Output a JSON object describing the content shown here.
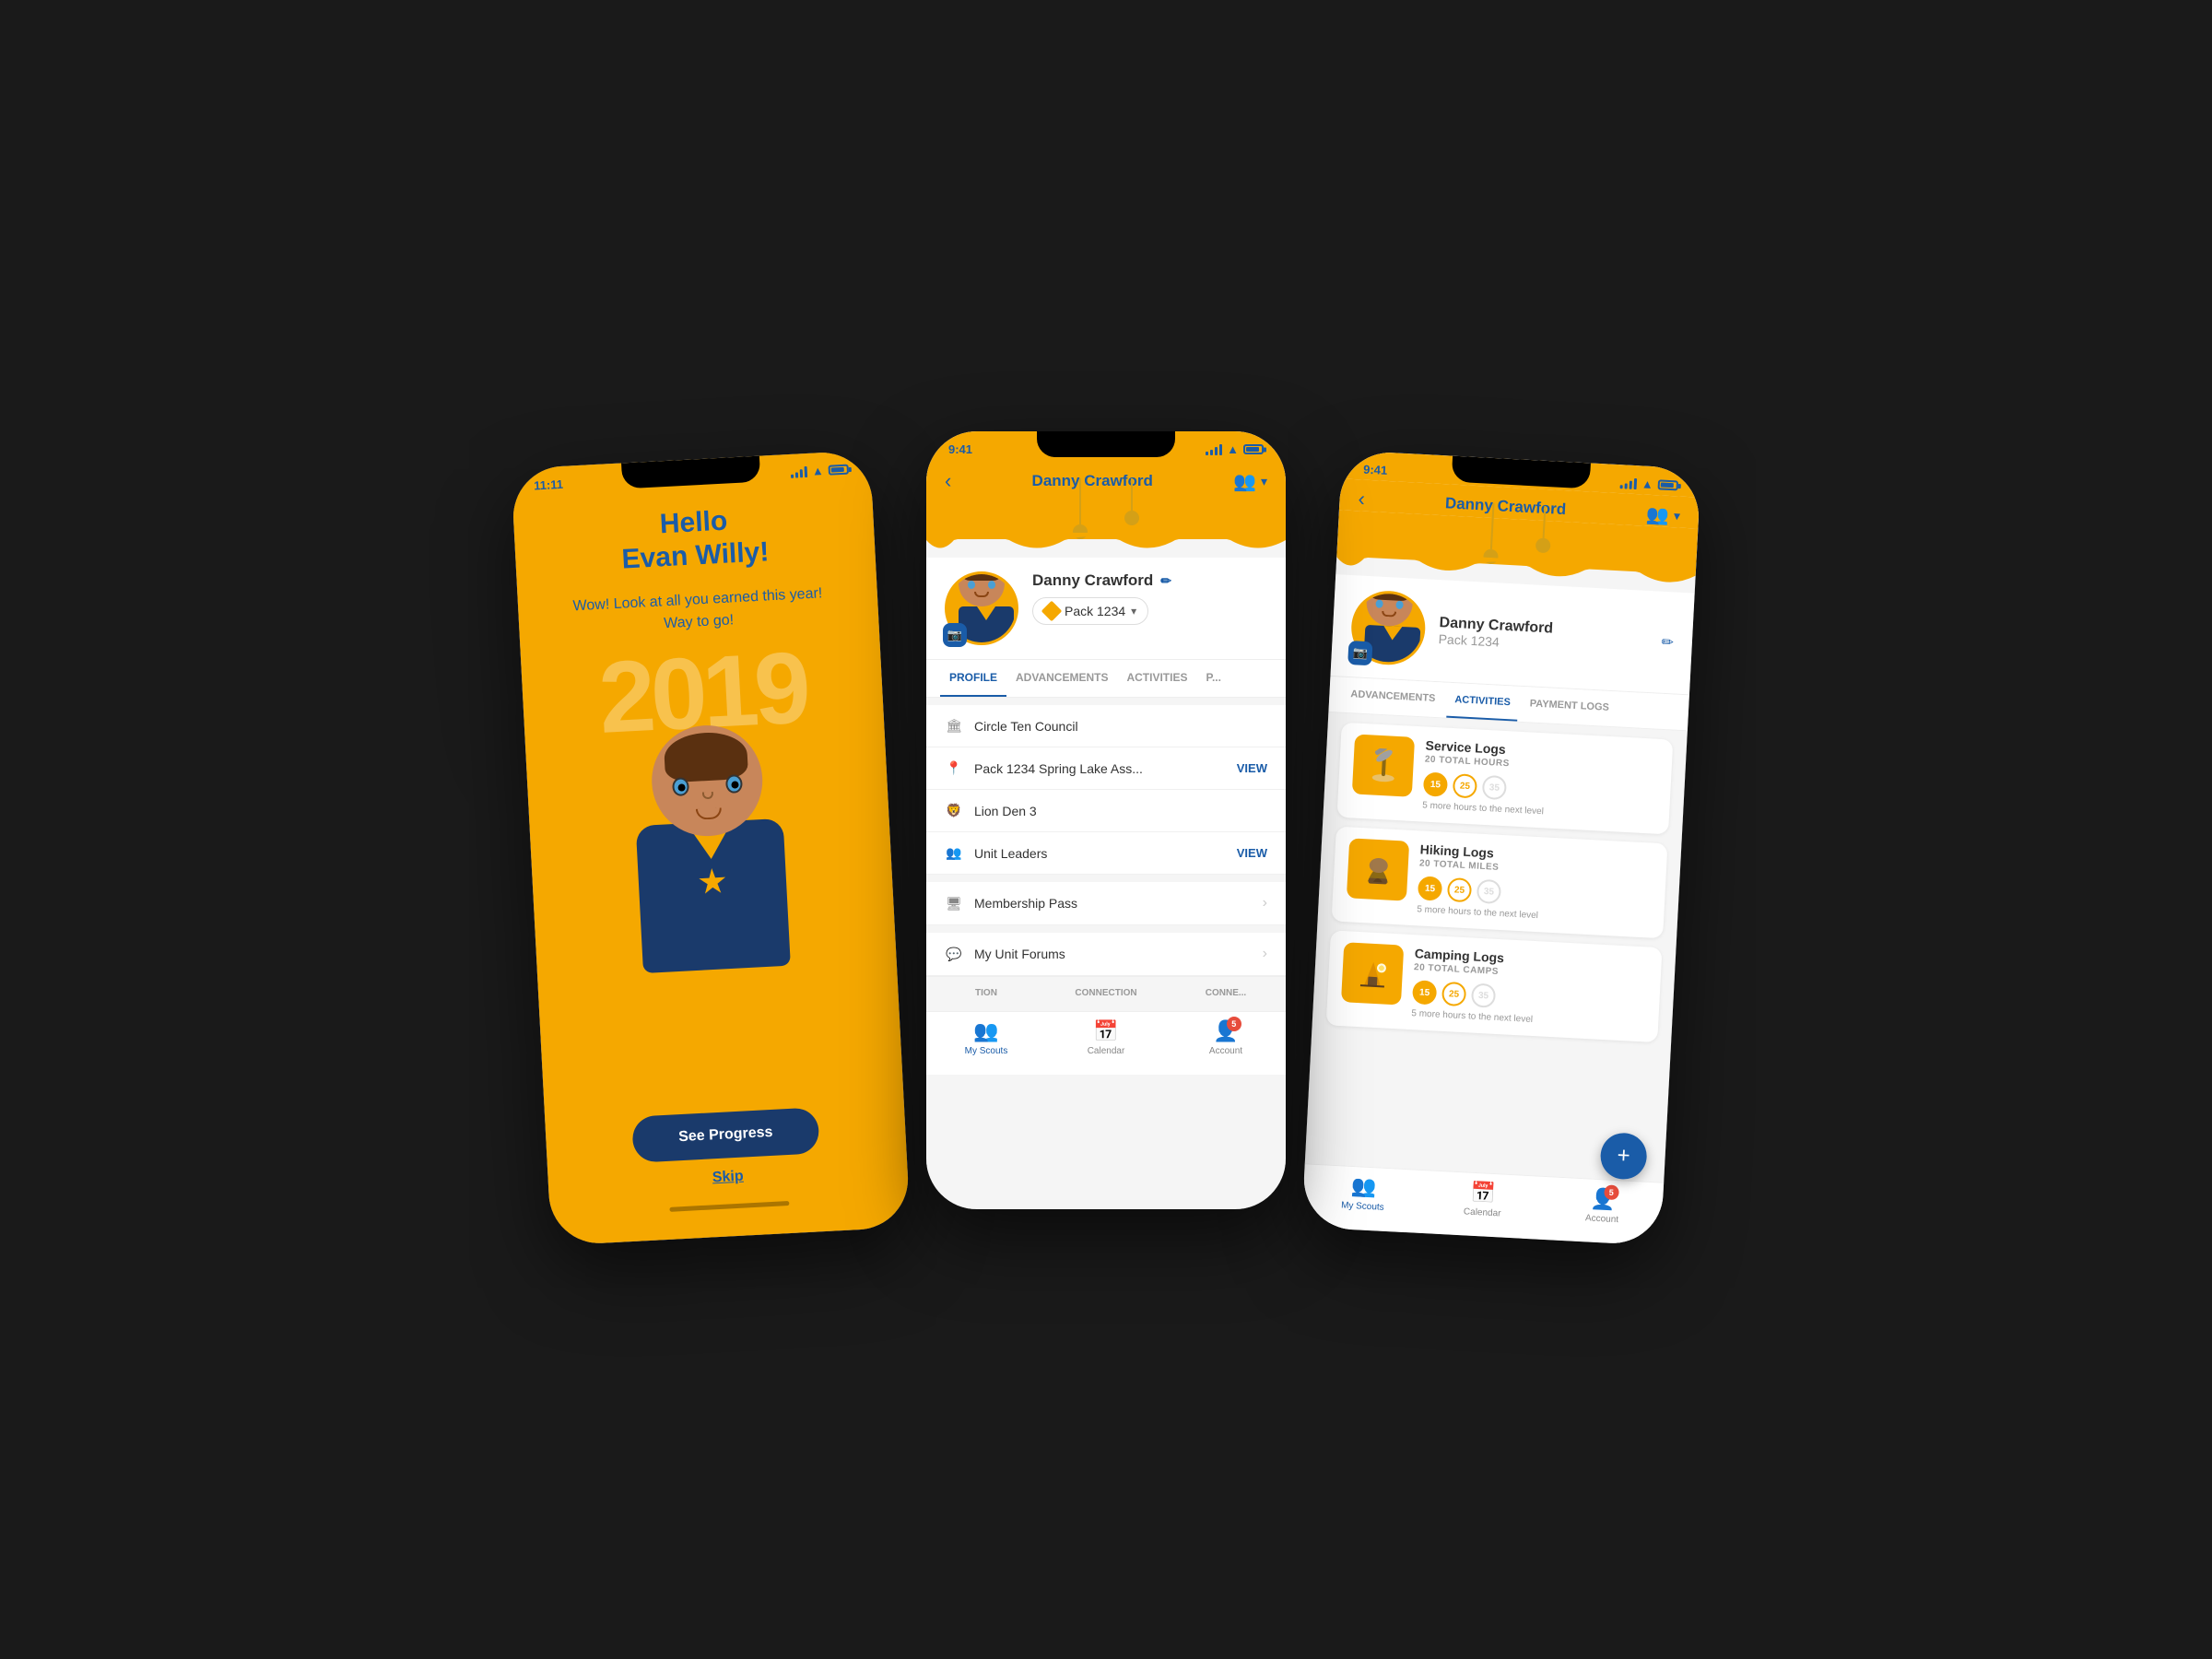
{
  "phone1": {
    "status_bar": {
      "time": "11:11",
      "signal": "signal",
      "wifi": "wifi",
      "battery": "battery"
    },
    "greeting": {
      "hello": "Hello",
      "name": "Evan Willy!",
      "subtitle_line1": "Wow!  Look at all you earned this year!",
      "subtitle_line2": "Way to go!",
      "year": "2019"
    },
    "buttons": {
      "see_progress": "See Progress",
      "skip": "Skip"
    }
  },
  "phone2": {
    "status_bar": {
      "time": "9:41"
    },
    "header": {
      "title": "Danny Crawford",
      "back_label": "‹"
    },
    "profile": {
      "name": "Danny Crawford",
      "pack": "Pack 1234"
    },
    "tabs": [
      {
        "label": "PROFILE",
        "active": true
      },
      {
        "label": "ADVANCEMENTS",
        "active": false
      },
      {
        "label": "ACTIVITIES",
        "active": false
      },
      {
        "label": "P...",
        "active": false
      }
    ],
    "list_items": [
      {
        "icon": "🏛",
        "text": "Circle Ten Council",
        "link": null
      },
      {
        "icon": "📍",
        "text": "Pack 1234 Spring Lake Ass...",
        "link": "VIEW"
      },
      {
        "icon": "🦁",
        "text": "Lion Den 3",
        "link": null
      },
      {
        "icon": "👥",
        "text": "Unit Leaders",
        "link": "VIEW"
      }
    ],
    "menu_items": [
      {
        "icon": "🖥",
        "text": "Membership Pass",
        "has_chevron": true
      },
      {
        "icon": "💬",
        "text": "My Unit Forums",
        "has_chevron": true
      }
    ],
    "bottom_tabs": [
      "TION",
      "CONNECTION",
      "CONNE..."
    ],
    "nav": {
      "my_scouts": "My Scouts",
      "calendar": "Calendar",
      "account": "Account",
      "badge_count": "5"
    }
  },
  "phone3": {
    "status_bar": {
      "time": "9:41"
    },
    "header": {
      "title": "Danny Crawford",
      "back_label": "‹"
    },
    "profile": {
      "name": "Danny Crawford",
      "pack": "Pack 1234"
    },
    "tabs": [
      {
        "label": "ADVANCEMENTS",
        "active": false
      },
      {
        "label": "ACTIVITIES",
        "active": true
      },
      {
        "label": "PAYMENT LOGS",
        "active": false
      }
    ],
    "activities": [
      {
        "icon": "🪓",
        "title": "Service Logs",
        "total": "20 TOTAL HOURS",
        "badges": [
          15,
          25,
          35
        ],
        "active_badges": 1,
        "next_level_text": "5 more hours to the next level"
      },
      {
        "icon": "🥾",
        "title": "Hiking Logs",
        "total": "20 TOTAL MILES",
        "badges": [
          15,
          25,
          35
        ],
        "active_badges": 1,
        "next_level_text": "5 more hours to the next level"
      },
      {
        "icon": "⛺",
        "title": "Camping Logs",
        "total": "20 TOTAL CAMPS",
        "badges": [
          15,
          25,
          35
        ],
        "active_badges": 1,
        "next_level_text": "5 more hours to the next level"
      }
    ],
    "fab_label": "+",
    "nav": {
      "my_scouts": "My Scouts",
      "calendar": "Calendar",
      "account": "Account",
      "badge_count": "5"
    }
  },
  "scouts_label": "Scouts"
}
